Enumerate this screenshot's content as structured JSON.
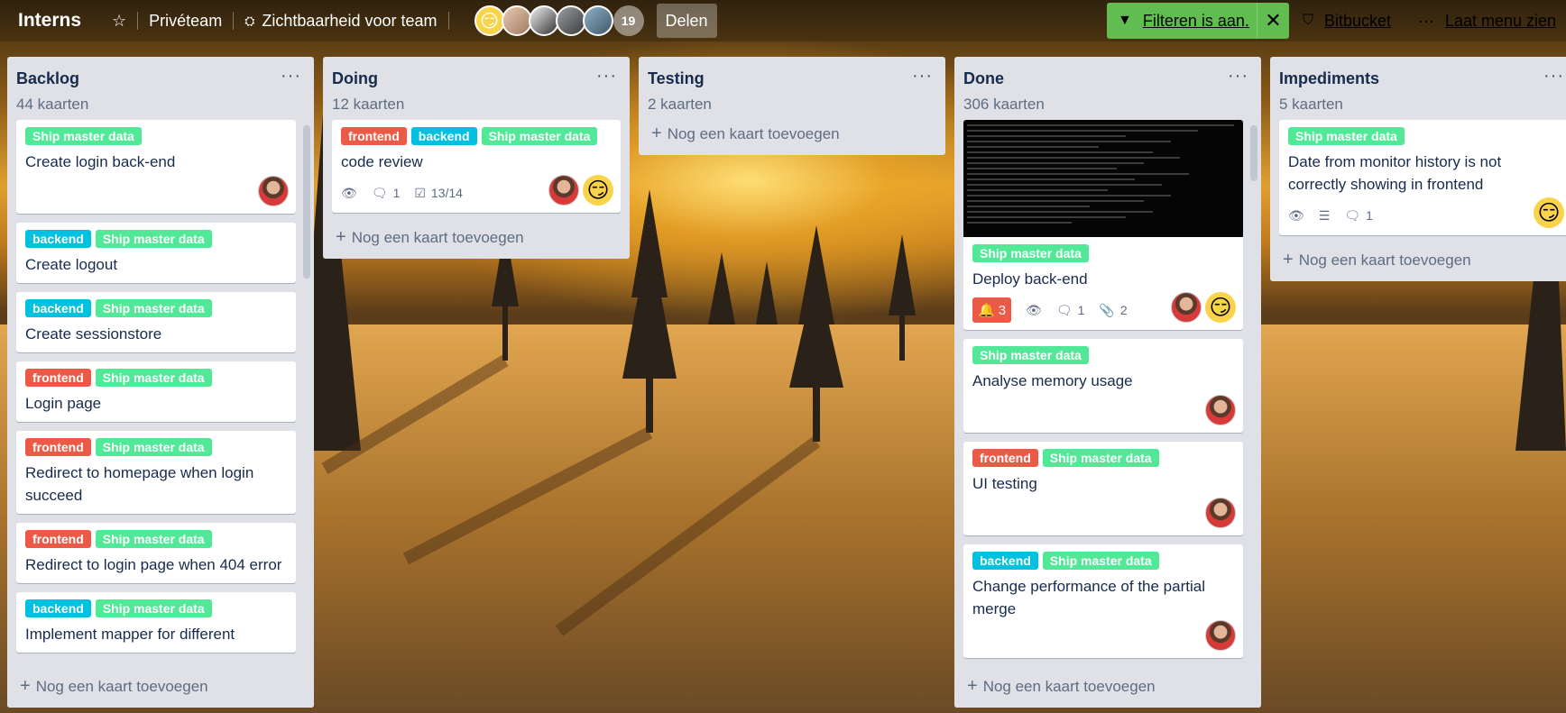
{
  "header": {
    "board_title": "Interns",
    "visibility": "Privéteam",
    "team_visibility": "Zichtbaarheid voor team",
    "member_count": "19",
    "share_label": "Delen",
    "filter_label": "Filteren is aan.",
    "bitbucket_label": "Bitbucket",
    "menu_label": "Laat menu zien"
  },
  "add_card_label": "Nog een kaart toevoegen",
  "lists": [
    {
      "title": "Backlog",
      "count": "44 kaarten",
      "cards": [
        {
          "labels": [
            "Ship master data"
          ],
          "title": "Create login back-end"
        },
        {
          "labels": [
            "backend",
            "Ship master data"
          ],
          "title": "Create logout"
        },
        {
          "labels": [
            "backend",
            "Ship master data"
          ],
          "title": "Create sessionstore"
        },
        {
          "labels": [
            "frontend",
            "Ship master data"
          ],
          "title": "Login page"
        },
        {
          "labels": [
            "frontend",
            "Ship master data"
          ],
          "title": "Redirect to homepage when login succeed"
        },
        {
          "labels": [
            "frontend",
            "Ship master data"
          ],
          "title": "Redirect to login page when 404 error"
        },
        {
          "labels": [
            "backend",
            "Ship master data"
          ],
          "title": "Implement mapper for different"
        }
      ]
    },
    {
      "title": "Doing",
      "count": "12 kaarten",
      "cards": [
        {
          "labels": [
            "frontend",
            "backend",
            "Ship master data"
          ],
          "title": "code review",
          "comments": "1",
          "checklist": "13/14"
        }
      ]
    },
    {
      "title": "Testing",
      "count": "2 kaarten",
      "cards": []
    },
    {
      "title": "Done",
      "count": "306 kaarten",
      "cards": [
        {
          "labels": [
            "Ship master data"
          ],
          "title": "Deploy back-end",
          "notifications": "3",
          "comments": "1",
          "attachments": "2"
        },
        {
          "labels": [
            "Ship master data"
          ],
          "title": "Analyse memory usage"
        },
        {
          "labels": [
            "frontend",
            "Ship master data"
          ],
          "title": "UI testing"
        },
        {
          "labels": [
            "backend",
            "Ship master data"
          ],
          "title": "Change performance of the partial merge"
        }
      ]
    },
    {
      "title": "Impediments",
      "count": "5 kaarten",
      "cards": [
        {
          "labels": [
            "Ship master data"
          ],
          "title": "Date from monitor history is not correctly showing in frontend",
          "comments": "1"
        }
      ]
    }
  ],
  "label_names": {
    "frontend": "frontend",
    "backend": "backend",
    "ship": "Ship master data"
  },
  "colors": {
    "label_frontend": "#eb5a46",
    "label_backend": "#00c2e0",
    "label_ship": "#51e898",
    "filter_green": "#61bd4f",
    "list_bg": "#dfe1e6"
  },
  "icons": {
    "star": "star-icon",
    "team": "team-icon",
    "filter": "funnel-icon",
    "close": "close-icon",
    "bitbucket": "bitbucket-icon",
    "menu": "more-icon",
    "watch": "eye-icon",
    "comment": "comment-icon",
    "checklist": "checkbox-icon",
    "description": "description-icon",
    "bell": "bell-icon",
    "attachment": "paperclip-icon"
  }
}
